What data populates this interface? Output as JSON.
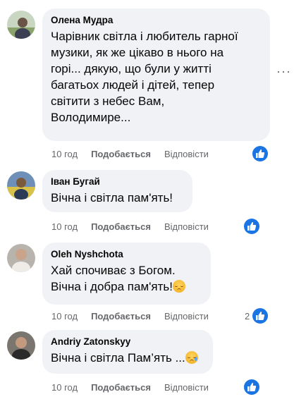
{
  "colors": {
    "bubble_bg": "#f0f2f5",
    "meta_text": "#65676b",
    "like_blue": "#1b74e4"
  },
  "icons": {
    "reaction": "thumbs-up-icon",
    "more": "more-options-icon"
  },
  "comments": [
    {
      "author": "Олена Мудра",
      "lines": [
        "Чарівник світла і любитель гарної",
        "музики, як же цікаво в нього на",
        "горі... дякую, що були у житті",
        "багатьох людей і дітей, тепер",
        "світити з небес Вам,",
        "Володимире..."
      ],
      "time": "10 год",
      "like_label": "Подобається",
      "reply_label": "Відповісти",
      "reaction_count": ""
    },
    {
      "author": "Іван Бугай",
      "lines": [
        "Вічна і світла пам'ять!"
      ],
      "time": "10 год",
      "like_label": "Подобається",
      "reply_label": "Відповісти",
      "reaction_count": ""
    },
    {
      "author": "Oleh Nyshchota",
      "lines": [
        "Хай спочиває з Богом.",
        "Вічна і добра пам'ять!"
      ],
      "time": "10 год",
      "like_label": "Подобається",
      "reply_label": "Відповісти",
      "reaction_count": "2"
    },
    {
      "author": "Andriy Zatonskyy",
      "lines": [
        "Вічна і світла Пам’ять ..."
      ],
      "time": "10 год",
      "like_label": "Подобається",
      "reply_label": "Відповісти",
      "reaction_count": ""
    }
  ]
}
